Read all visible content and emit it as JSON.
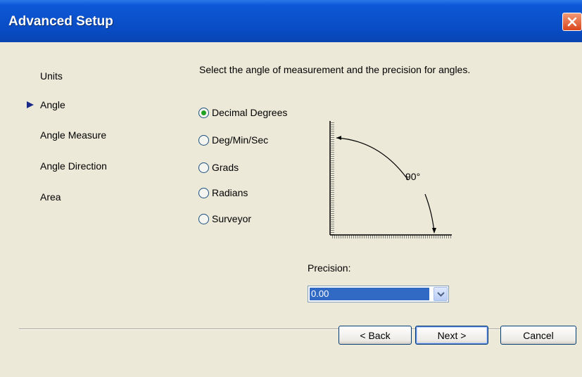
{
  "window": {
    "title": "Advanced Setup"
  },
  "nav": {
    "items": [
      {
        "label": "Units",
        "active": false
      },
      {
        "label": "Angle",
        "active": true
      },
      {
        "label": "Angle Measure",
        "active": false
      },
      {
        "label": "Angle Direction",
        "active": false
      },
      {
        "label": "Area",
        "active": false
      }
    ]
  },
  "instructions": "Select the angle of measurement and the precision for angles.",
  "angle_options": [
    {
      "label": "Decimal Degrees",
      "selected": true
    },
    {
      "label": "Deg/Min/Sec",
      "selected": false
    },
    {
      "label": "Grads",
      "selected": false
    },
    {
      "label": "Radians",
      "selected": false
    },
    {
      "label": "Surveyor",
      "selected": false
    }
  ],
  "diagram": {
    "angle_label": "90°"
  },
  "precision": {
    "label": "Precision:",
    "value": "0.00"
  },
  "buttons": {
    "back": "< Back",
    "next": "Next >",
    "cancel": "Cancel"
  },
  "colors": {
    "titlebar": "#0a4fc8",
    "dialog_bg": "#ece9d8",
    "selection": "#316ac5",
    "radio_dot": "#21a121",
    "nav_arrow": "#1a2a8a"
  },
  "icons": {
    "close": "close-icon",
    "arrow": "triangle-right-icon",
    "dropdown": "chevron-down-icon"
  }
}
